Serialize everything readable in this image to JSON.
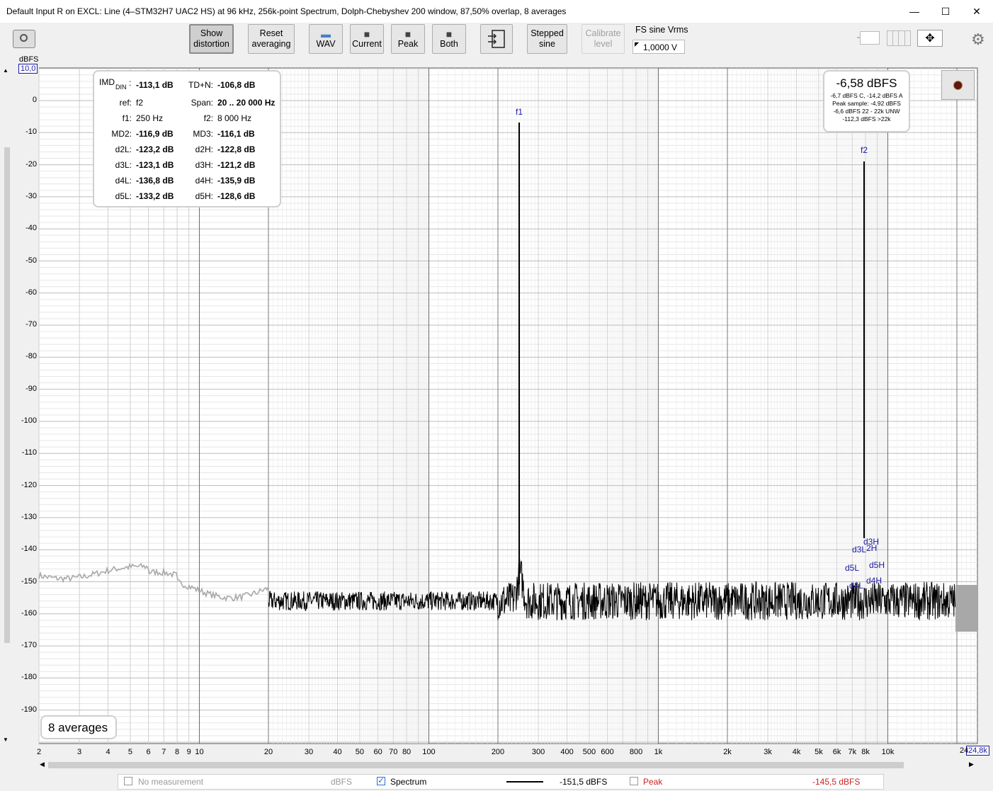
{
  "window": {
    "title": "Default Input R on EXCL: Line (4–STM32H7 UAC2 HS) at 96 kHz, 256k-point Spectrum, Dolph-Chebyshev 200 window, 87,50% overlap, 8 averages",
    "minimize": "—",
    "maximize": "☐",
    "close": "✕"
  },
  "toolbar": {
    "show_distortion": [
      "Show",
      "distortion"
    ],
    "reset_averaging": [
      "Reset",
      "averaging"
    ],
    "wav": "WAV",
    "current": "Current",
    "peak": "Peak",
    "both": "Both",
    "stepped_sine": [
      "Stepped",
      "sine"
    ],
    "calibrate_level": [
      "Calibrate",
      "level"
    ],
    "fs_label": "FS sine Vrms",
    "fs_value": "1,0000 V"
  },
  "plot": {
    "y_unit": "dBFS",
    "y_top_value": "10,0",
    "x_right_value": "24,8k",
    "x_right_partial": "24",
    "y_ticks": [
      "0",
      "-10",
      "-20",
      "-30",
      "-40",
      "-50",
      "-60",
      "-70",
      "-80",
      "-90",
      "-100",
      "-110",
      "-120",
      "-130",
      "-140",
      "-150",
      "-160",
      "-170",
      "-180",
      "-190"
    ],
    "x_ticks": [
      "2",
      "3",
      "4",
      "5",
      "6",
      "7",
      "8",
      "9",
      "10",
      "20",
      "30",
      "40",
      "50",
      "60",
      "70",
      "80",
      "100",
      "200",
      "300",
      "400",
      "500",
      "600",
      "800",
      "1k",
      "2k",
      "3k",
      "4k",
      "5k",
      "6k",
      "7k",
      "8k",
      "10k"
    ],
    "markers": {
      "f1": "f1",
      "f2": "f2",
      "d3H": "d3H",
      "d3L": "d3L",
      "d2H": "2H",
      "d5L": "d5L",
      "d5H": "d5H",
      "d4L": "d4L",
      "d4H": "d4H"
    }
  },
  "imd": {
    "imd_label": "IMD",
    "imd_sub": "DIN",
    "imd_value": "-113,1 dB",
    "tdn_label": "TD+N:",
    "tdn_value": "-106,8 dB",
    "ref_label": "ref:",
    "ref_value": "f2",
    "span_label": "Span:",
    "span_value": "20 .. 20 000 Hz",
    "f1_label": "f1:",
    "f1_value": "250 Hz",
    "f2_label": "f2:",
    "f2_value": "8 000 Hz",
    "rows": [
      {
        "l": "MD2:",
        "lv": "-116,9 dB",
        "r": "MD3:",
        "rv": "-116,1 dB"
      },
      {
        "l": "d2L:",
        "lv": "-123,2 dB",
        "r": "d2H:",
        "rv": "-122,8 dB"
      },
      {
        "l": "d3L:",
        "lv": "-123,1 dB",
        "r": "d3H:",
        "rv": "-121,2 dB"
      },
      {
        "l": "d4L:",
        "lv": "-136,8 dB",
        "r": "d4H:",
        "rv": "-135,9 dB"
      },
      {
        "l": "d5L:",
        "lv": "-133,2 dB",
        "r": "d5H:",
        "rv": "-128,6 dB"
      }
    ]
  },
  "level": {
    "main": "-6,58 dBFS",
    "line1": "-6,7 dBFS C, -14,2 dBFS A",
    "line2": "Peak sample: -4,92 dBFS",
    "line3": "-6,6 dBFS 22 - 22k UNW",
    "line4": "-112,3 dBFS >22k"
  },
  "averages": "8 averages",
  "status": {
    "no_measurement": "No measurement",
    "dbfs": "dBFS",
    "spectrum": "Spectrum",
    "spectrum_value": "-151,5 dBFS",
    "peak": "Peak",
    "peak_value": "-145,5 dBFS"
  },
  "colors": {
    "marker": "#1a1aa0",
    "peak": "#cc2222",
    "trace": "#000000",
    "grey_trace": "#a8a8a8"
  }
}
